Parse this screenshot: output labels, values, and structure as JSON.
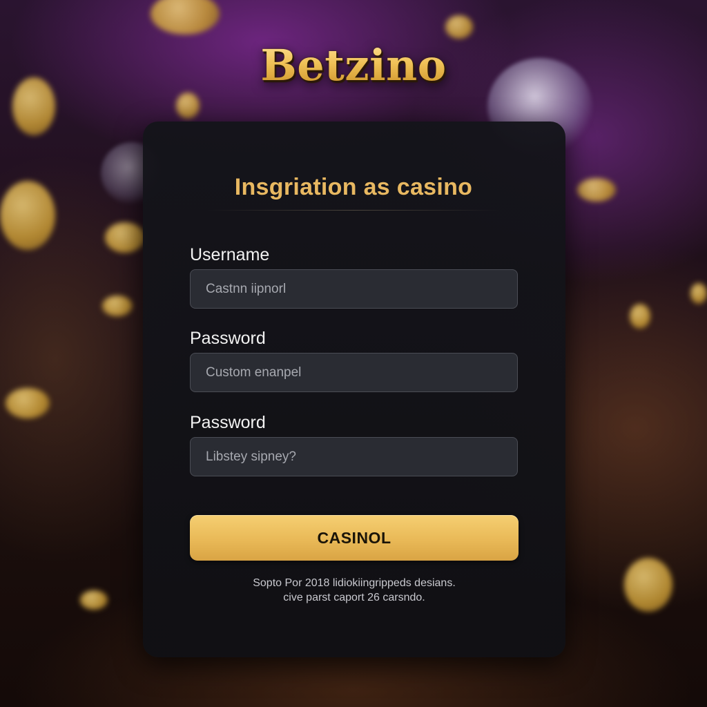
{
  "logo": {
    "text": "Betzino"
  },
  "form": {
    "title": "Insgriation as casino",
    "fields": [
      {
        "label": "Username",
        "placeholder": "Castnn iipnorl"
      },
      {
        "label": "Password",
        "placeholder": "Custom enanpel"
      },
      {
        "label": "Password",
        "placeholder": "Libstey sipney?"
      }
    ],
    "submit_label": "CASINOL",
    "footnote_lines": [
      "Sopto Por 2018 lidiokiingrippeds desians.",
      "cive parst caport 26 carsndo."
    ]
  },
  "colors": {
    "accent_gold": "#e8b861",
    "button_gold": "#e9b957",
    "card_background": "#141418",
    "input_background": "#2a2c33"
  }
}
